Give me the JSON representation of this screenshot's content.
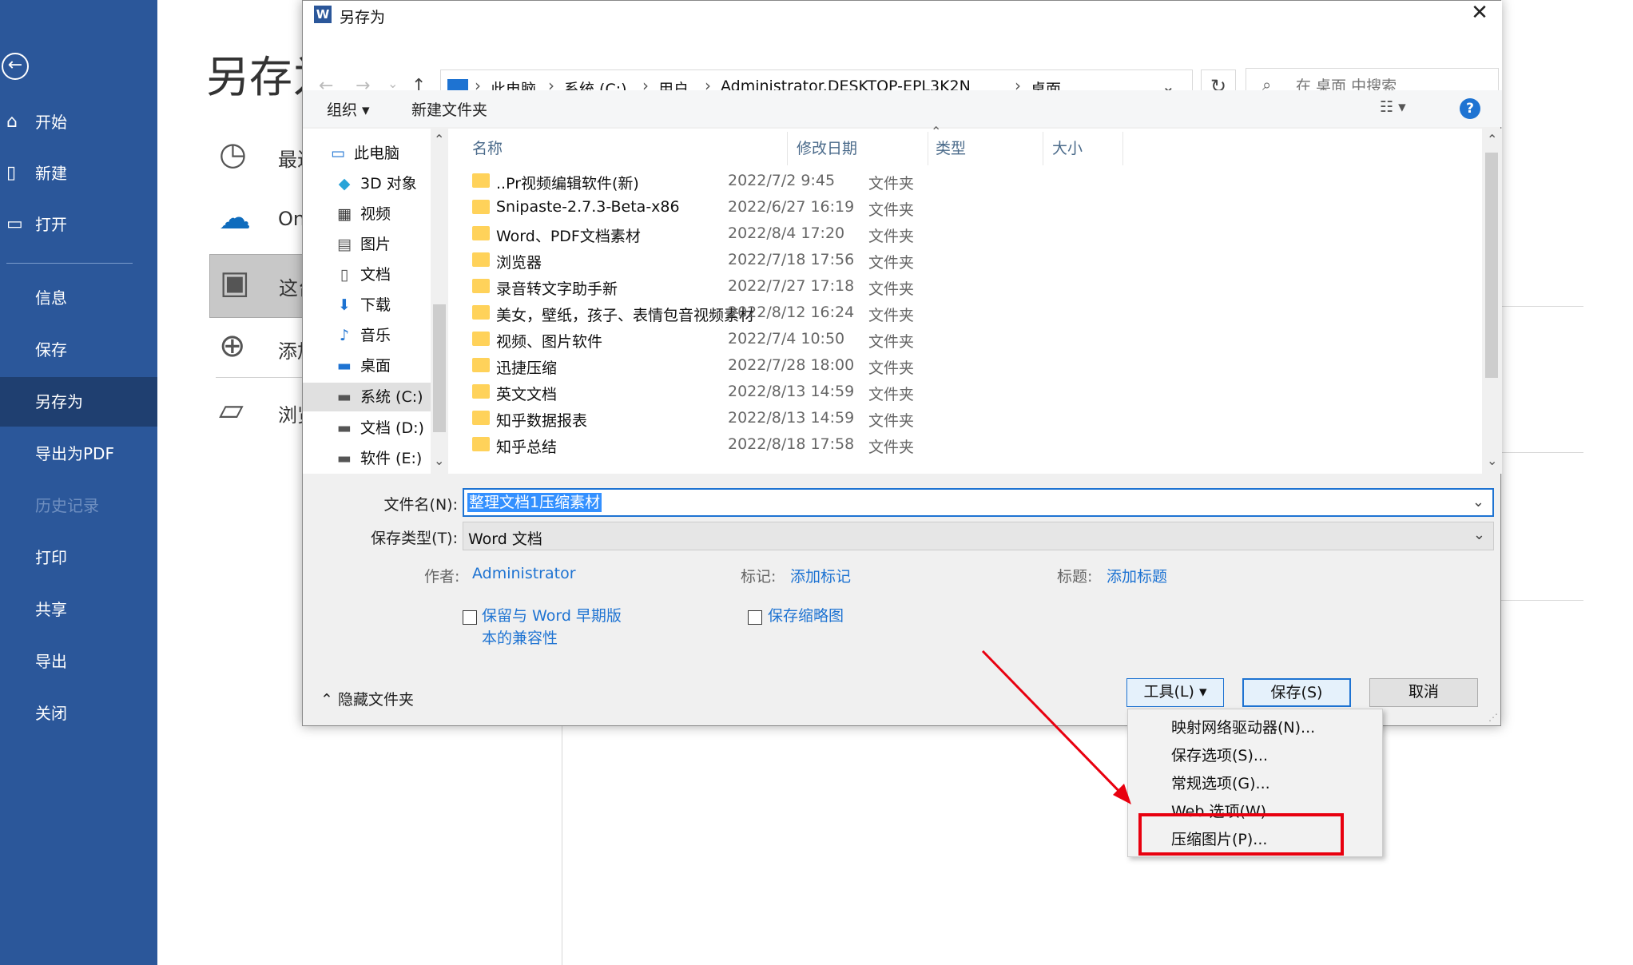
{
  "sidebar": {
    "back_icon": "back-arrow-icon",
    "items": [
      {
        "label": "开始",
        "icon": "home-icon",
        "state": "normal"
      },
      {
        "label": "新建",
        "icon": "new-document-icon",
        "state": "normal"
      },
      {
        "label": "打开",
        "icon": "open-folder-icon",
        "state": "normal"
      },
      {
        "label": "信息",
        "state": "normal"
      },
      {
        "label": "保存",
        "state": "normal"
      },
      {
        "label": "另存为",
        "state": "active"
      },
      {
        "label": "导出为PDF",
        "state": "normal"
      },
      {
        "label": "历史记录",
        "state": "disabled"
      },
      {
        "label": "打印",
        "state": "normal"
      },
      {
        "label": "共享",
        "state": "normal"
      },
      {
        "label": "导出",
        "state": "normal"
      },
      {
        "label": "关闭",
        "state": "normal"
      }
    ],
    "colors": {
      "bg": "#2b579a",
      "active_bg": "#1f3f70"
    }
  },
  "backstage": {
    "title": "另存为",
    "locations": [
      {
        "label": "最近",
        "icon": "clock-icon"
      },
      {
        "label": "OneDrive",
        "icon": "onedrive-cloud-icon"
      },
      {
        "label": "这台电脑",
        "icon": "this-pc-icon"
      },
      {
        "label": "添加位置",
        "icon": "add-location-globe-icon"
      },
      {
        "label": "浏览",
        "icon": "browse-folder-icon"
      }
    ]
  },
  "dialog": {
    "title": "另存为",
    "app_icon": "word-icon",
    "close_label": "✕",
    "nav": {
      "back": "←",
      "forward": "→",
      "recent": "⌄",
      "up": "↑"
    },
    "breadcrumb": [
      "此电脑",
      "系统 (C:)",
      "用户",
      "Administrator.DESKTOP-EPL3K2N",
      "桌面"
    ],
    "search_placeholder": "在 桌面 中搜索",
    "toolbar": {
      "organize": "组织 ▾",
      "new_folder": "新建文件夹",
      "view": "☷ ▾",
      "help": "?"
    },
    "tree": [
      {
        "label": "此电脑",
        "icon": "pc-icon",
        "indent": 0
      },
      {
        "label": "3D 对象",
        "icon": "3d-objects-icon",
        "indent": 1
      },
      {
        "label": "视频",
        "icon": "video-icon",
        "indent": 1
      },
      {
        "label": "图片",
        "icon": "pictures-icon",
        "indent": 1
      },
      {
        "label": "文档",
        "icon": "documents-icon",
        "indent": 1
      },
      {
        "label": "下载",
        "icon": "download-icon",
        "indent": 1
      },
      {
        "label": "音乐",
        "icon": "music-icon",
        "indent": 1
      },
      {
        "label": "桌面",
        "icon": "desktop-icon",
        "indent": 1
      },
      {
        "label": "系统 (C:)",
        "icon": "drive-c-icon",
        "indent": 1,
        "selected": true
      },
      {
        "label": "文档 (D:)",
        "icon": "drive-icon",
        "indent": 1
      },
      {
        "label": "软件 (E:)",
        "icon": "drive-icon",
        "indent": 1
      }
    ],
    "columns": [
      "名称",
      "修改日期",
      "类型",
      "大小"
    ],
    "files": [
      {
        "name": "..Pr视频编辑软件(新)",
        "date": "2022/7/2 9:45",
        "type": "文件夹"
      },
      {
        "name": "Snipaste-2.7.3-Beta-x86",
        "date": "2022/6/27 16:19",
        "type": "文件夹"
      },
      {
        "name": "Word、PDF文档素材",
        "date": "2022/8/4 17:20",
        "type": "文件夹"
      },
      {
        "name": "浏览器",
        "date": "2022/7/18 17:56",
        "type": "文件夹"
      },
      {
        "name": "录音转文字助手新",
        "date": "2022/7/27 17:18",
        "type": "文件夹"
      },
      {
        "name": "美女，壁纸，孩子、表情包音视频素材",
        "date": "2022/8/12 16:24",
        "type": "文件夹"
      },
      {
        "name": "视频、图片软件",
        "date": "2022/7/4 10:50",
        "type": "文件夹"
      },
      {
        "name": "迅捷压缩",
        "date": "2022/7/28 18:00",
        "type": "文件夹"
      },
      {
        "name": "英文文档",
        "date": "2022/8/13 14:59",
        "type": "文件夹"
      },
      {
        "name": "知乎数据报表",
        "date": "2022/8/13 14:59",
        "type": "文件夹"
      },
      {
        "name": "知乎总结",
        "date": "2022/8/18 17:58",
        "type": "文件夹"
      }
    ],
    "filename_label": "文件名(N):",
    "filename_value": "整理文档1压缩素材",
    "filetype_label": "保存类型(T):",
    "filetype_value": "Word 文档",
    "meta": {
      "author_label": "作者:",
      "author_value": "Administrator",
      "tags_label": "标记:",
      "tags_value": "添加标记",
      "title_label": "标题:",
      "title_value": "添加标题"
    },
    "compat_line1": "保留与 Word 早期版",
    "compat_line2": "本的兼容性",
    "thumbnail_label": "保存缩略图",
    "hide_folders": "隐藏文件夹",
    "buttons": {
      "tools": "工具(L)",
      "save": "保存(S)",
      "cancel": "取消"
    },
    "tools_menu": [
      "映射网络驱动器(N)...",
      "保存选项(S)...",
      "常规选项(G)...",
      "Web 选项(W)...",
      "压缩图片(P)..."
    ],
    "highlighted_menu_item": "压缩图片(P)...",
    "annotation_color": "#e8000f"
  }
}
